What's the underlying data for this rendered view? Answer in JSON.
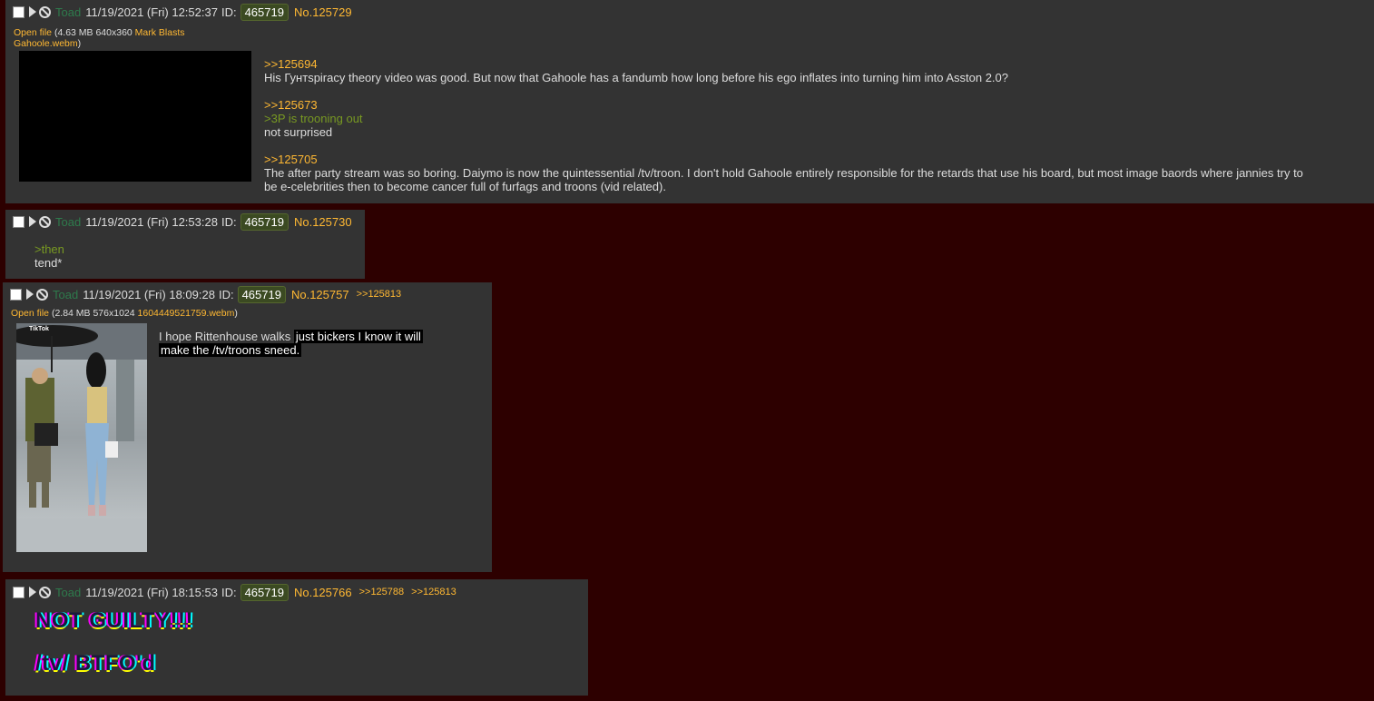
{
  "posts": [
    {
      "name": "Toad",
      "date": "11/19/2021 (Fri) 12:52:37",
      "id_label": "ID:",
      "id": "465719",
      "number": "No.125729",
      "file": {
        "link": "Open file",
        "meta": " (4.63 MB 640x360 ",
        "filename_line1": "Mark Blasts",
        "filename_line2": "Gahoole.webm",
        "close": ")"
      },
      "lines": [
        {
          "type": "quote",
          "text": ">>125694"
        },
        {
          "type": "text",
          "text": "His Гунтspiracy theory video was good. But now that Gahoole has a fandumb how long before his ego inflates into turning him into Asston 2.0?"
        },
        {
          "type": "quote",
          "text": ">>125673"
        },
        {
          "type": "green",
          "text": ">3P is trooning out"
        },
        {
          "type": "text",
          "text": "not surprised"
        },
        {
          "type": "quote",
          "text": ">>125705"
        },
        {
          "type": "text",
          "text": "The after party stream was so boring. Daiymo is now the quintessential /tv/troon. I don't hold Gahoole entirely responsible for the retards that use his board, but most image baords where jannies try to"
        },
        {
          "type": "text",
          "text": "be e-celebrities then to become cancer full of furfags and troons (vid related)."
        }
      ]
    },
    {
      "name": "Toad",
      "date": "11/19/2021 (Fri) 12:53:28",
      "id_label": "ID:",
      "id": "465719",
      "number": "No.125730",
      "lines": [
        {
          "type": "green",
          "text": ">then"
        },
        {
          "type": "text",
          "text": "tend*"
        }
      ]
    },
    {
      "name": "Toad",
      "date": "11/19/2021 (Fri) 18:09:28",
      "id_label": "ID:",
      "id": "465719",
      "number": "No.125757",
      "backlinks": [
        ">>125813"
      ],
      "file": {
        "link": "Open file",
        "meta": " (2.84 MB 576x1024 ",
        "filename_line1": "1604449521759.webm",
        "close": ")"
      },
      "thumb_caption": "TikTok",
      "lines": [
        {
          "type": "text",
          "text": "I hope Rittenhouse walks"
        },
        {
          "type": "highlight",
          "text": "just bickers I know it will"
        },
        {
          "type": "highlight",
          "text": "make the /tv/troons sneed."
        }
      ]
    },
    {
      "name": "Toad",
      "date": "11/19/2021 (Fri) 18:15:53",
      "id_label": "ID:",
      "id": "465719",
      "number": "No.125766",
      "backlinks": [
        ">>125788",
        ">>125813"
      ],
      "lines": [
        {
          "type": "glitch",
          "text": "NOT GUILTY!!!"
        },
        {
          "type": "glitch",
          "text": "/tv/ BTFO'd"
        }
      ]
    }
  ]
}
